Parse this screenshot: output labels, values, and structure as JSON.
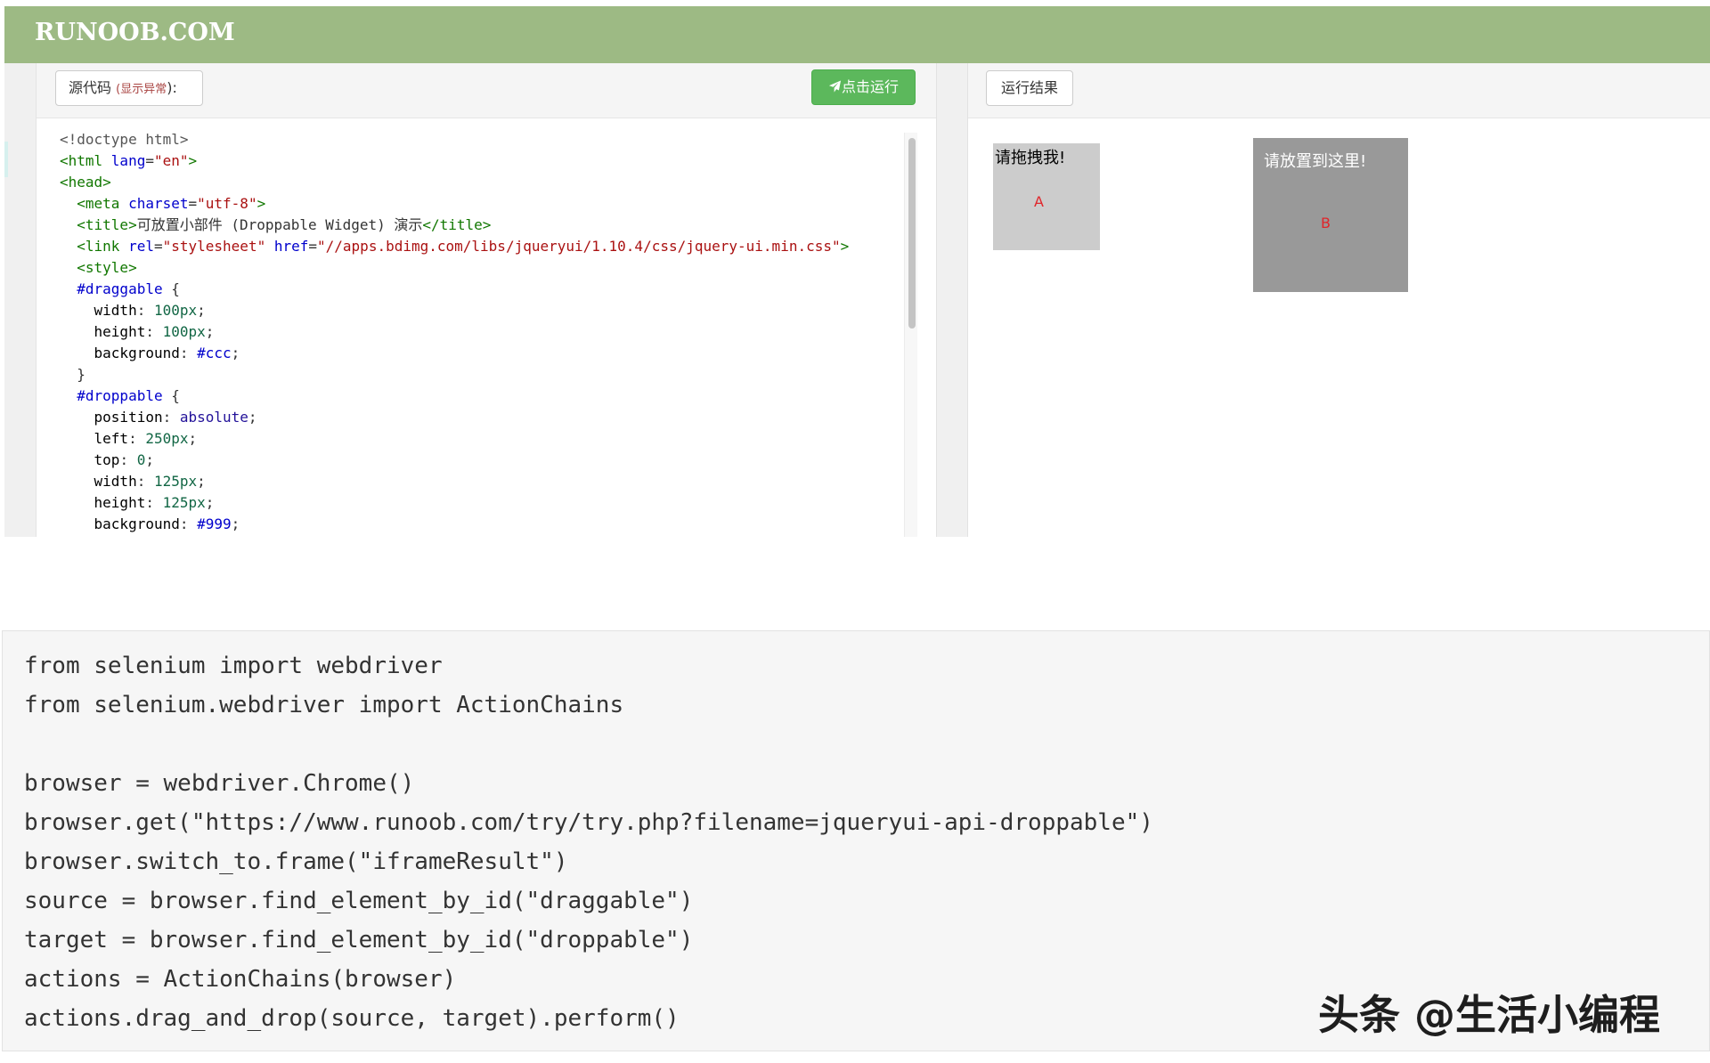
{
  "header": {
    "logo": "RUNOOB.COM"
  },
  "left_panel": {
    "source_button": {
      "label": "源代码",
      "paren_open": "(",
      "warning": "显示异常",
      "suffix": "):"
    },
    "run_button": {
      "icon": "paper-plane-icon",
      "label": "点击运行"
    },
    "code_lines": [
      "<!doctype html>",
      "<html lang=\"en\">",
      "<head>",
      "  <meta charset=\"utf-8\">",
      "  <title>可放置小部件 (Droppable Widget) 演示</title>",
      "  <link rel=\"stylesheet\" href=\"//apps.bdimg.com/libs/jqueryui/1.10.4/css/jquery-ui.min.css\">",
      "  <style>",
      "  #draggable {",
      "    width: 100px;",
      "    height: 100px;",
      "    background: #ccc;",
      "  }",
      "  #droppable {",
      "    position: absolute;",
      "    left: 250px;",
      "    top: 0;",
      "    width: 125px;",
      "    height: 125px;",
      "    background: #999;"
    ]
  },
  "right_panel": {
    "result_button": {
      "label": "运行结果"
    },
    "draggable": {
      "label": "请拖拽我!",
      "letter": "A"
    },
    "droppable": {
      "label": "请放置到这里!",
      "letter": "B"
    }
  },
  "python_code": [
    "from selenium import webdriver",
    "from selenium.webdriver import ActionChains",
    "",
    "browser = webdriver.Chrome()",
    "browser.get(\"https://www.runoob.com/try/try.php?filename=jqueryui-api-droppable\")",
    "browser.switch_to.frame(\"iframeResult\")",
    "source = browser.find_element_by_id(\"draggable\")",
    "target = browser.find_element_by_id(\"droppable\")",
    "actions = ActionChains(browser)",
    "actions.drag_and_drop(source, target).perform()"
  ],
  "watermark": "头条 @生活小编程",
  "colors": {
    "header_green": "#9dba84",
    "run_button_green": "#5cb85c",
    "draggable_bg": "#cccccc",
    "droppable_bg": "#999999",
    "letter_red": "#e0262b"
  }
}
